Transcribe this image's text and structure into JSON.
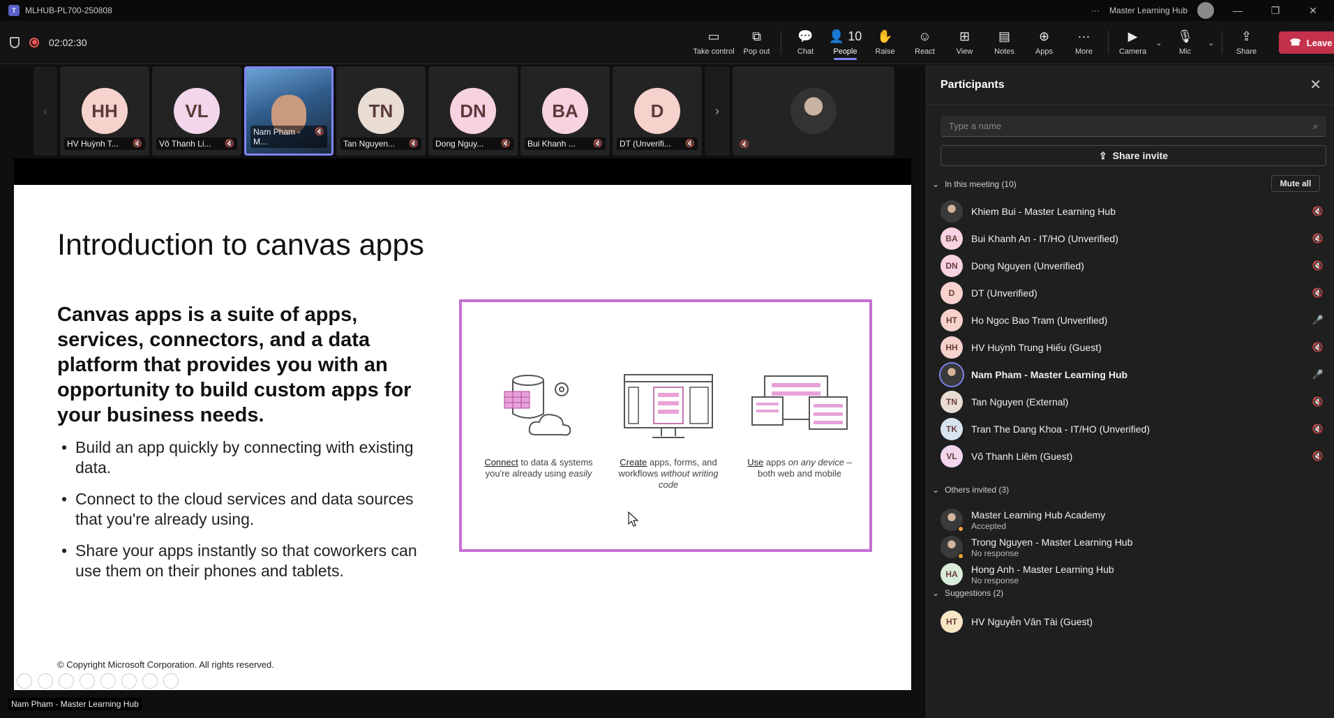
{
  "window": {
    "title": "MLHUB-PL700-250808",
    "account": "Master Learning Hub",
    "more": "···"
  },
  "meeting": {
    "timer": "02:02:30"
  },
  "toolbar": {
    "items": [
      {
        "label": "Take control",
        "icon": "take-control-icon",
        "glyph": "▭"
      },
      {
        "label": "Pop out",
        "icon": "pop-out-icon",
        "glyph": "⧉"
      },
      {
        "label": "Chat",
        "icon": "chat-icon",
        "glyph": "💬"
      },
      {
        "label": "People",
        "icon": "people-icon",
        "glyph": "👤",
        "count": "10"
      },
      {
        "label": "Raise",
        "icon": "raise-hand-icon",
        "glyph": "✋"
      },
      {
        "label": "React",
        "icon": "react-icon",
        "glyph": "☺"
      },
      {
        "label": "View",
        "icon": "view-icon",
        "glyph": "⊞"
      },
      {
        "label": "Notes",
        "icon": "notes-icon",
        "glyph": "▤"
      },
      {
        "label": "Apps",
        "icon": "apps-icon",
        "glyph": "⊕"
      },
      {
        "label": "More",
        "icon": "more-icon",
        "glyph": "···"
      },
      {
        "label": "Camera",
        "icon": "camera-off-icon",
        "glyph": "▶"
      },
      {
        "label": "Mic",
        "icon": "mic-off-icon",
        "glyph": "🎙"
      },
      {
        "label": "Share",
        "icon": "share-icon",
        "glyph": "⇪"
      }
    ],
    "leave": "Leave"
  },
  "strip": [
    {
      "initials": "HH",
      "name": "HV Huỳnh T...",
      "color": "#f6d2cc"
    },
    {
      "initials": "VL",
      "name": "Võ Thanh Li...",
      "color": "#f2d6ec"
    },
    {
      "initials": "",
      "name": "Nam Pham - M...",
      "color": ""
    },
    {
      "initials": "TN",
      "name": "Tan Nguyen...",
      "color": "#e9dcd3"
    },
    {
      "initials": "DN",
      "name": "Dong Nguy...",
      "color": "#f7d2e0"
    },
    {
      "initials": "BA",
      "name": "Bui Khanh ...",
      "color": "#f7d2e0"
    },
    {
      "initials": "D",
      "name": "DT (Unverifi...",
      "color": "#f6d2cc"
    }
  ],
  "slide": {
    "title": "Introduction to canvas apps",
    "lead": "Canvas apps is a suite of apps, services, connectors, and a data platform that provides you with an opportunity to build custom apps for your business needs.",
    "bullets": [
      "Build an app quickly by connecting with existing data.",
      "Connect to the cloud services and data sources that you're already using.",
      "Share your apps instantly so that coworkers can use them on their phones and tablets."
    ],
    "features": [
      {
        "u": "Connect",
        "rest": " to data & systems you're already using ",
        "em": "easily"
      },
      {
        "u": "Create",
        "rest": " apps, forms, and workflows ",
        "em": "without writing code"
      },
      {
        "u": "Use",
        "rest": " apps ",
        "em": "on any device",
        "tail": " – both web and mobile"
      }
    ],
    "copyright": "© Copyright Microsoft Corporation. All rights reserved."
  },
  "presenter": "Nam Pham - Master Learning Hub",
  "panel": {
    "title": "Participants",
    "search_placeholder": "Type a name",
    "share_invite": "Share invite",
    "in_meeting": "In this meeting (10)",
    "mute_all": "Mute all",
    "participants": [
      {
        "initials": "",
        "name": "Khiem Bui - Master Learning Hub",
        "color": "",
        "mic": "off"
      },
      {
        "initials": "BA",
        "name": "Bui Khanh An - IT/HO (Unverified)",
        "color": "#f7d2e0",
        "mic": "off"
      },
      {
        "initials": "DN",
        "name": "Dong Nguyen (Unverified)",
        "color": "#f7d2e0",
        "mic": "off"
      },
      {
        "initials": "D",
        "name": "DT (Unverified)",
        "color": "#f6d2cc",
        "mic": "off"
      },
      {
        "initials": "HT",
        "name": "Ho Ngoc Bao Tram (Unverified)",
        "color": "#f6d2cc",
        "mic": "on"
      },
      {
        "initials": "HH",
        "name": "HV Huỳnh Trung Hiếu (Guest)",
        "color": "#f6d2cc",
        "mic": "off"
      },
      {
        "initials": "",
        "name": "Nam Pham - Master Learning Hub",
        "color": "",
        "mic": "on"
      },
      {
        "initials": "TN",
        "name": "Tan Nguyen (External)",
        "color": "#e9dcd3",
        "mic": "off"
      },
      {
        "initials": "TK",
        "name": "Tran The Dang Khoa - IT/HO (Unverified)",
        "color": "#d6e4f0",
        "mic": "off"
      },
      {
        "initials": "VL",
        "name": "Võ Thanh Liêm (Guest)",
        "color": "#f2d6ec",
        "mic": "off"
      }
    ],
    "others_invited": "Others invited (3)",
    "invited": [
      {
        "initials": "",
        "name": "Master Learning Hub Academy",
        "status": "Accepted",
        "color": ""
      },
      {
        "initials": "",
        "name": "Trong Nguyen - Master Learning Hub",
        "status": "No response",
        "color": ""
      },
      {
        "initials": "HA",
        "name": "Hong Anh - Master Learning Hub",
        "status": "No response",
        "color": "#d9ecd9"
      }
    ],
    "suggestions": "Suggestions (2)",
    "suggested": [
      {
        "initials": "HT",
        "name": "HV Nguyễn Văn Tài (Guest)",
        "color": "#f7e6c4"
      }
    ]
  }
}
